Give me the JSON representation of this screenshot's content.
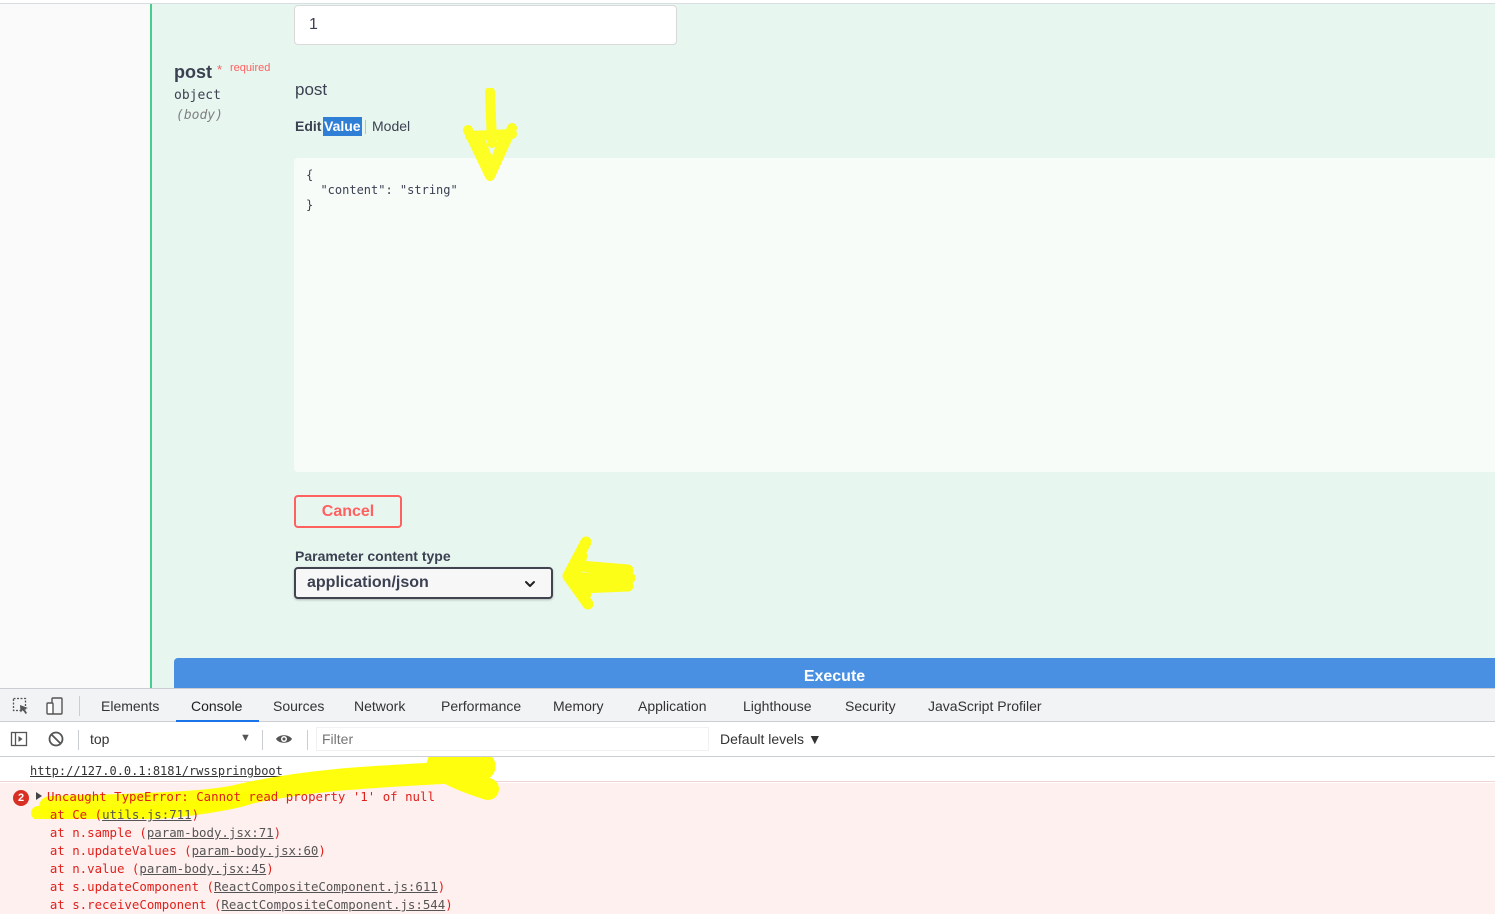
{
  "param_value_input": {
    "value": "1"
  },
  "parameter": {
    "name": "post",
    "required_star": "*",
    "required_label": "required",
    "type": "object",
    "location": "(body)",
    "description": "post"
  },
  "body_tabs": {
    "edit": "Edit",
    "value": "Value",
    "model": "Model"
  },
  "body_editor": {
    "json": "{\n  \"content\": \"string\"\n}"
  },
  "cancel_label": "Cancel",
  "content_type": {
    "label": "Parameter content type",
    "selected": "application/json"
  },
  "execute_label": "Execute",
  "colors": {
    "panel_bg": "#e8f6f0",
    "panel_border": "#49cc90",
    "execute_blue": "#4990e2",
    "cancel_red": "#ff6060",
    "marker_yellow": "#ffff00",
    "error_red": "#e0201a"
  },
  "icons": {
    "inspect": "cursor-select-icon",
    "device": "device-toggle-icon",
    "sidebar": "console-sidebar-icon",
    "clear": "clear-console-icon",
    "eye": "live-expression-eye-icon",
    "select": "chevron-down-icon"
  },
  "devtools": {
    "tabs": [
      "Elements",
      "Console",
      "Sources",
      "Network",
      "Performance",
      "Memory",
      "Application",
      "Lighthouse",
      "Security",
      "JavaScript Profiler"
    ],
    "active_tab": "Console",
    "context": "top",
    "filter_placeholder": "Filter",
    "levels": "Default levels ▼"
  },
  "console": {
    "url": "http://127.0.0.1:8181/rwsspringboot",
    "error_count": "2",
    "error_message": "Uncaught TypeError: Cannot read property '1' of null",
    "stack": [
      {
        "prefix": "    at Ce (",
        "source": "utils.js:711",
        "suffix": ")"
      },
      {
        "prefix": "    at n.sample (",
        "source": "param-body.jsx:71",
        "suffix": ")"
      },
      {
        "prefix": "    at n.updateValues (",
        "source": "param-body.jsx:60",
        "suffix": ")"
      },
      {
        "prefix": "    at n.value (",
        "source": "param-body.jsx:45",
        "suffix": ")"
      },
      {
        "prefix": "    at s.updateComponent (",
        "source": "ReactCompositeComponent.js:611",
        "suffix": ")"
      },
      {
        "prefix": "    at s.receiveComponent (",
        "source": "ReactCompositeComponent.js:544",
        "suffix": ")"
      }
    ]
  }
}
